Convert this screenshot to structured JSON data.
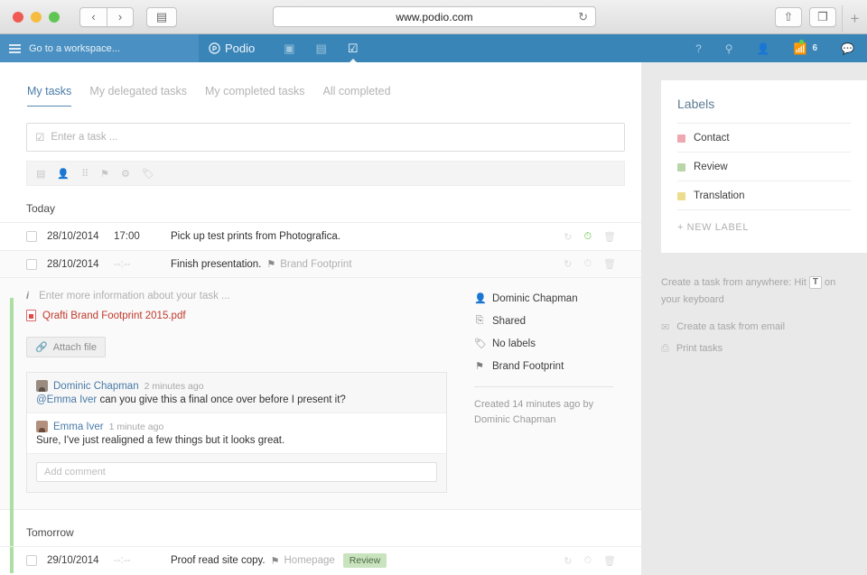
{
  "browser": {
    "url": "www.podio.com",
    "back_label": "‹",
    "forward_label": "›",
    "sidebar_label": "▤",
    "reload_label": "↻",
    "share_label": "⇧",
    "tabs_label": "❐",
    "newtab_label": "+"
  },
  "topnav": {
    "workspace_label": "Go to a workspace...",
    "brand": "Podio",
    "icons": [
      {
        "name": "apps-icon",
        "glyph": "▣"
      },
      {
        "name": "calendar-icon",
        "glyph": "▤"
      },
      {
        "name": "tasks-icon",
        "glyph": "☑"
      }
    ],
    "help_label": "?",
    "search_label": "⚲",
    "people_label": "👤",
    "activity_label": "📶",
    "activity_count": "6",
    "chat_label": "💬"
  },
  "tabs": [
    {
      "label": "My tasks",
      "active": true
    },
    {
      "label": "My delegated tasks",
      "active": false
    },
    {
      "label": "My completed tasks",
      "active": false
    },
    {
      "label": "All completed",
      "active": false
    }
  ],
  "entry": {
    "placeholder": "Enter a task ...",
    "check_glyph": "☑",
    "toolbar": [
      {
        "name": "calendar-icon",
        "glyph": "▤"
      },
      {
        "name": "person-icon",
        "glyph": "👤"
      },
      {
        "name": "grid-icon",
        "glyph": "⠿"
      },
      {
        "name": "flag-icon",
        "glyph": "⚑"
      },
      {
        "name": "gear-icon",
        "glyph": "⚙"
      },
      {
        "name": "tag-icon",
        "glyph": "🏷"
      }
    ]
  },
  "sections": [
    {
      "heading": "Today",
      "rows": [
        {
          "date": "28/10/2014",
          "time": "17:00",
          "title": "Pick up test prints from Photografica.",
          "reference": "",
          "chip": "",
          "alarm_active": true,
          "alt": false
        },
        {
          "date": "28/10/2014",
          "time": "--:--",
          "title": "Finish presentation.",
          "reference": "Brand Footprint",
          "chip": "",
          "alarm_active": false,
          "alt": true
        }
      ]
    },
    {
      "heading": "Tomorrow",
      "rows": [
        {
          "date": "29/10/2014",
          "time": "--:--",
          "title": "Proof read site copy.",
          "reference": "Homepage",
          "chip": "Review",
          "alarm_active": false,
          "alt": false
        }
      ]
    }
  ],
  "row_actions": {
    "refresh_glyph": "↻",
    "alarm_glyph": "⏱",
    "delete_glyph": "🗑"
  },
  "detail": {
    "description_placeholder": "Enter more information about your task ...",
    "info_glyph": "i",
    "file_name": "Qrafti Brand Footprint 2015.pdf",
    "attach_label": "Attach file",
    "attach_glyph": "🔗",
    "comments": [
      {
        "author": "Dominic Chapman",
        "time": "2 minutes ago",
        "mention": "@Emma Iver",
        "text": " can you give this a final once over before I present it?"
      },
      {
        "author": "Emma Iver",
        "time": "1 minute ago",
        "mention": "",
        "text": "Sure, I've just realigned a few things but it looks great."
      }
    ],
    "add_comment_placeholder": "Add comment",
    "meta": [
      {
        "icon_name": "person-icon",
        "glyph": "👤",
        "text": "Dominic Chapman"
      },
      {
        "icon_name": "shared-icon",
        "glyph": "⎘",
        "text": "Shared"
      },
      {
        "icon_name": "tag-icon",
        "glyph": "🏷",
        "text": "No labels"
      },
      {
        "icon_name": "flag-icon",
        "glyph": "⚑",
        "text": "Brand Footprint"
      }
    ],
    "created_text": "Created 14 minutes ago by Dominic Chapman"
  },
  "sidebar": {
    "title": "Labels",
    "labels": [
      {
        "name": "Contact",
        "color": "#f0a8b0"
      },
      {
        "name": "Review",
        "color": "#b9d6a8"
      },
      {
        "name": "Translation",
        "color": "#ecdc8e"
      }
    ],
    "new_label": "+ NEW LABEL",
    "tip_prefix": "Create a task from anywhere: Hit",
    "tip_key": "T",
    "tip_suffix": "on your keyboard",
    "actions": [
      {
        "icon_name": "email-icon",
        "glyph": "✉",
        "label": "Create a task from email"
      },
      {
        "icon_name": "print-icon",
        "glyph": "⎙",
        "label": "Print tasks"
      }
    ]
  }
}
